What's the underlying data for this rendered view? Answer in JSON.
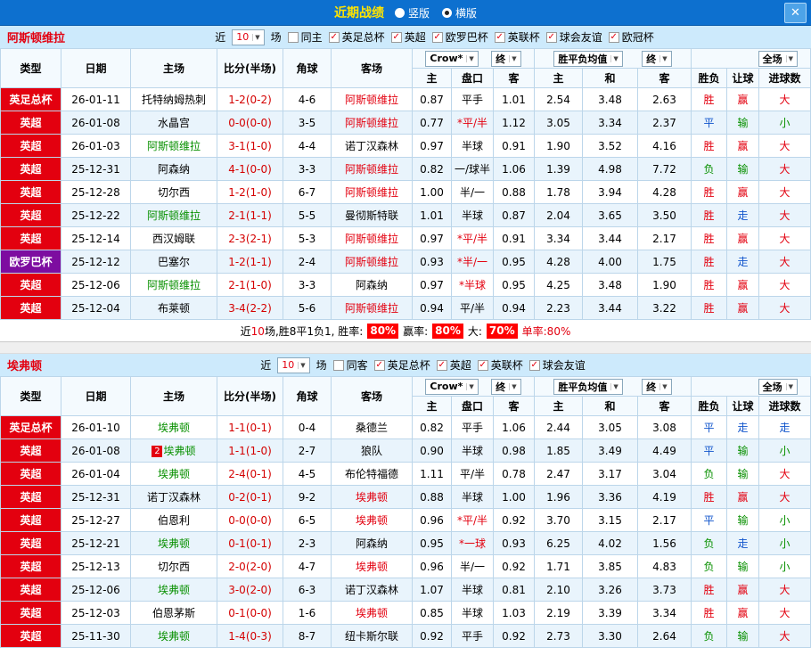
{
  "topbar": {
    "title": "近期战绩",
    "radios": [
      {
        "label": "竖版",
        "selected": false
      },
      {
        "label": "横版",
        "selected": true
      }
    ],
    "close_label": "✕"
  },
  "filter_labels": {
    "near": "近",
    "games": "场"
  },
  "table_headers": {
    "type": "类型",
    "date": "日期",
    "home": "主场",
    "score": "比分(半场)",
    "corner": "角球",
    "away": "客场",
    "odds_source": "Crow*",
    "odds_final": "终",
    "avg_label": "胜平负均值",
    "avg_final": "终",
    "scope": "全场",
    "sub": [
      "主",
      "盘口",
      "客",
      "主",
      "和",
      "客",
      "胜负",
      "让球",
      "进球数"
    ]
  },
  "colors": {
    "league_red": "#e3000f",
    "league_purple": "#7d0da0",
    "win": "#e3000f",
    "draw": "#1155cc",
    "lose": "#089000",
    "team_home": "#089000",
    "team_away": "#e3000f",
    "score": "#d40000"
  },
  "sections": [
    {
      "team": "阿斯顿维拉",
      "match_count": "10",
      "same_venue_label": "同主",
      "same_venue_checked": false,
      "competitions": [
        {
          "label": "英足总杯",
          "checked": true
        },
        {
          "label": "英超",
          "checked": true
        },
        {
          "label": "欧罗巴杯",
          "checked": true
        },
        {
          "label": "英联杯",
          "checked": true
        },
        {
          "label": "球会友谊",
          "checked": true
        },
        {
          "label": "欧冠杯",
          "checked": true
        }
      ],
      "rows": [
        {
          "type": "英足总杯",
          "type_color": "league_red",
          "date": "26-01-11",
          "home": "托特纳姆热刺",
          "home_role": "opp",
          "score": "1-2(0-2)",
          "corner": "4-6",
          "away": "阿斯顿维拉",
          "away_role": "self",
          "odds": [
            "0.87",
            "平手",
            "1.01"
          ],
          "avg": [
            "2.54",
            "3.48",
            "2.63"
          ],
          "result": "胜",
          "handicap": "赢",
          "goals": "大"
        },
        {
          "type": "英超",
          "type_color": "league_red",
          "date": "26-01-08",
          "home": "水晶宫",
          "home_role": "opp",
          "score": "0-0(0-0)",
          "corner": "3-5",
          "away": "阿斯顿维拉",
          "away_role": "self",
          "odds": [
            "0.77",
            "*平/半",
            "1.12"
          ],
          "avg": [
            "3.05",
            "3.34",
            "2.37"
          ],
          "result": "平",
          "handicap": "输",
          "goals": "小"
        },
        {
          "type": "英超",
          "type_color": "league_red",
          "date": "26-01-03",
          "home": "阿斯顿维拉",
          "home_role": "self",
          "score": "3-1(1-0)",
          "corner": "4-4",
          "away": "诺丁汉森林",
          "away_role": "opp",
          "odds": [
            "0.97",
            "半球",
            "0.91"
          ],
          "avg": [
            "1.90",
            "3.52",
            "4.16"
          ],
          "result": "胜",
          "handicap": "赢",
          "goals": "大"
        },
        {
          "type": "英超",
          "type_color": "league_red",
          "date": "25-12-31",
          "home": "阿森纳",
          "home_role": "opp",
          "score": "4-1(0-0)",
          "corner": "3-3",
          "away": "阿斯顿维拉",
          "away_role": "self",
          "odds": [
            "0.82",
            "一/球半",
            "1.06"
          ],
          "avg": [
            "1.39",
            "4.98",
            "7.72"
          ],
          "result": "负",
          "handicap": "输",
          "goals": "大"
        },
        {
          "type": "英超",
          "type_color": "league_red",
          "date": "25-12-28",
          "home": "切尔西",
          "home_role": "opp",
          "score": "1-2(1-0)",
          "corner": "6-7",
          "away": "阿斯顿维拉",
          "away_role": "self",
          "odds": [
            "1.00",
            "半/一",
            "0.88"
          ],
          "avg": [
            "1.78",
            "3.94",
            "4.28"
          ],
          "result": "胜",
          "handicap": "赢",
          "goals": "大"
        },
        {
          "type": "英超",
          "type_color": "league_red",
          "date": "25-12-22",
          "home": "阿斯顿维拉",
          "home_role": "self",
          "score": "2-1(1-1)",
          "corner": "5-5",
          "away": "曼彻斯特联",
          "away_role": "opp",
          "odds": [
            "1.01",
            "半球",
            "0.87"
          ],
          "avg": [
            "2.04",
            "3.65",
            "3.50"
          ],
          "result": "胜",
          "handicap": "走",
          "goals": "大"
        },
        {
          "type": "英超",
          "type_color": "league_red",
          "date": "25-12-14",
          "home": "西汉姆联",
          "home_role": "opp",
          "score": "2-3(2-1)",
          "corner": "5-3",
          "away": "阿斯顿维拉",
          "away_role": "self",
          "odds": [
            "0.97",
            "*平/半",
            "0.91"
          ],
          "avg": [
            "3.34",
            "3.44",
            "2.17"
          ],
          "result": "胜",
          "handicap": "赢",
          "goals": "大"
        },
        {
          "type": "欧罗巴杯",
          "type_color": "league_purple",
          "date": "25-12-12",
          "home": "巴塞尔",
          "home_role": "opp",
          "score": "1-2(1-1)",
          "corner": "2-4",
          "away": "阿斯顿维拉",
          "away_role": "self",
          "odds": [
            "0.93",
            "*半/一",
            "0.95"
          ],
          "avg": [
            "4.28",
            "4.00",
            "1.75"
          ],
          "result": "胜",
          "handicap": "走",
          "goals": "大"
        },
        {
          "type": "英超",
          "type_color": "league_red",
          "date": "25-12-06",
          "home": "阿斯顿维拉",
          "home_role": "self",
          "score": "2-1(1-0)",
          "corner": "3-3",
          "away": "阿森纳",
          "away_role": "opp",
          "odds": [
            "0.97",
            "*半球",
            "0.95"
          ],
          "avg": [
            "4.25",
            "3.48",
            "1.90"
          ],
          "result": "胜",
          "handicap": "赢",
          "goals": "大"
        },
        {
          "type": "英超",
          "type_color": "league_red",
          "date": "25-12-04",
          "home": "布莱顿",
          "home_role": "opp",
          "score": "3-4(2-2)",
          "corner": "5-6",
          "away": "阿斯顿维拉",
          "away_role": "self",
          "odds": [
            "0.94",
            "平/半",
            "0.94"
          ],
          "avg": [
            "2.23",
            "3.44",
            "3.22"
          ],
          "result": "胜",
          "handicap": "赢",
          "goals": "大"
        }
      ],
      "summary": {
        "text_before": "近",
        "count": "10",
        "text_after": "场,胜8平1负1, 胜率:",
        "win_rate": "80%",
        "label_profit": "赢率:",
        "profit_rate": "80%",
        "label_big": "大:",
        "big_rate": "70%",
        "single": "单率:80%"
      }
    },
    {
      "team": "埃弗顿",
      "match_count": "10",
      "same_venue_label": "同客",
      "same_venue_checked": false,
      "competitions": [
        {
          "label": "英足总杯",
          "checked": true
        },
        {
          "label": "英超",
          "checked": true
        },
        {
          "label": "英联杯",
          "checked": true
        },
        {
          "label": "球会友谊",
          "checked": true
        }
      ],
      "rows": [
        {
          "type": "英足总杯",
          "type_color": "league_red",
          "date": "26-01-10",
          "home": "埃弗顿",
          "home_role": "self",
          "score": "1-1(0-1)",
          "corner": "0-4",
          "away": "桑德兰",
          "away_role": "opp",
          "odds": [
            "0.82",
            "平手",
            "1.06"
          ],
          "avg": [
            "2.44",
            "3.05",
            "3.08"
          ],
          "result": "平",
          "handicap": "走",
          "goals": "走"
        },
        {
          "type": "英超",
          "type_color": "league_red",
          "date": "26-01-08",
          "home": "埃弗顿",
          "home_role": "self",
          "home_badge": "2",
          "score": "1-1(1-0)",
          "corner": "2-7",
          "away": "狼队",
          "away_role": "opp",
          "odds": [
            "0.90",
            "半球",
            "0.98"
          ],
          "avg": [
            "1.85",
            "3.49",
            "4.49"
          ],
          "result": "平",
          "handicap": "输",
          "goals": "小"
        },
        {
          "type": "英超",
          "type_color": "league_red",
          "date": "26-01-04",
          "home": "埃弗顿",
          "home_role": "self",
          "score": "2-4(0-1)",
          "corner": "4-5",
          "away": "布伦特福德",
          "away_role": "opp",
          "odds": [
            "1.11",
            "平/半",
            "0.78"
          ],
          "avg": [
            "2.47",
            "3.17",
            "3.04"
          ],
          "result": "负",
          "handicap": "输",
          "goals": "大"
        },
        {
          "type": "英超",
          "type_color": "league_red",
          "date": "25-12-31",
          "home": "诺丁汉森林",
          "home_role": "opp",
          "score": "0-2(0-1)",
          "corner": "9-2",
          "away": "埃弗顿",
          "away_role": "self",
          "odds": [
            "0.88",
            "半球",
            "1.00"
          ],
          "avg": [
            "1.96",
            "3.36",
            "4.19"
          ],
          "result": "胜",
          "handicap": "赢",
          "goals": "大"
        },
        {
          "type": "英超",
          "type_color": "league_red",
          "date": "25-12-27",
          "home": "伯恩利",
          "home_role": "opp",
          "score": "0-0(0-0)",
          "corner": "6-5",
          "away": "埃弗顿",
          "away_role": "self",
          "odds": [
            "0.96",
            "*平/半",
            "0.92"
          ],
          "avg": [
            "3.70",
            "3.15",
            "2.17"
          ],
          "result": "平",
          "handicap": "输",
          "goals": "小"
        },
        {
          "type": "英超",
          "type_color": "league_red",
          "date": "25-12-21",
          "home": "埃弗顿",
          "home_role": "self",
          "score": "0-1(0-1)",
          "corner": "2-3",
          "away": "阿森纳",
          "away_role": "opp",
          "odds": [
            "0.95",
            "*一球",
            "0.93"
          ],
          "avg": [
            "6.25",
            "4.02",
            "1.56"
          ],
          "result": "负",
          "handicap": "走",
          "goals": "小"
        },
        {
          "type": "英超",
          "type_color": "league_red",
          "date": "25-12-13",
          "home": "切尔西",
          "home_role": "opp",
          "score": "2-0(2-0)",
          "corner": "4-7",
          "away": "埃弗顿",
          "away_role": "self",
          "odds": [
            "0.96",
            "半/一",
            "0.92"
          ],
          "avg": [
            "1.71",
            "3.85",
            "4.83"
          ],
          "result": "负",
          "handicap": "输",
          "goals": "小"
        },
        {
          "type": "英超",
          "type_color": "league_red",
          "date": "25-12-06",
          "home": "埃弗顿",
          "home_role": "self",
          "score": "3-0(2-0)",
          "corner": "6-3",
          "away": "诺丁汉森林",
          "away_role": "opp",
          "odds": [
            "1.07",
            "半球",
            "0.81"
          ],
          "avg": [
            "2.10",
            "3.26",
            "3.73"
          ],
          "result": "胜",
          "handicap": "赢",
          "goals": "大"
        },
        {
          "type": "英超",
          "type_color": "league_red",
          "date": "25-12-03",
          "home": "伯恩茅斯",
          "home_role": "opp",
          "score": "0-1(0-0)",
          "corner": "1-6",
          "away": "埃弗顿",
          "away_role": "self",
          "odds": [
            "0.85",
            "半球",
            "1.03"
          ],
          "avg": [
            "2.19",
            "3.39",
            "3.34"
          ],
          "result": "胜",
          "handicap": "赢",
          "goals": "大"
        },
        {
          "type": "英超",
          "type_color": "league_red",
          "date": "25-11-30",
          "home": "埃弗顿",
          "home_role": "self",
          "score": "1-4(0-3)",
          "corner": "8-7",
          "away": "纽卡斯尔联",
          "away_role": "opp",
          "odds": [
            "0.92",
            "平手",
            "0.92"
          ],
          "avg": [
            "2.73",
            "3.30",
            "2.64"
          ],
          "result": "负",
          "handicap": "输",
          "goals": "大"
        }
      ],
      "summary": null
    }
  ]
}
